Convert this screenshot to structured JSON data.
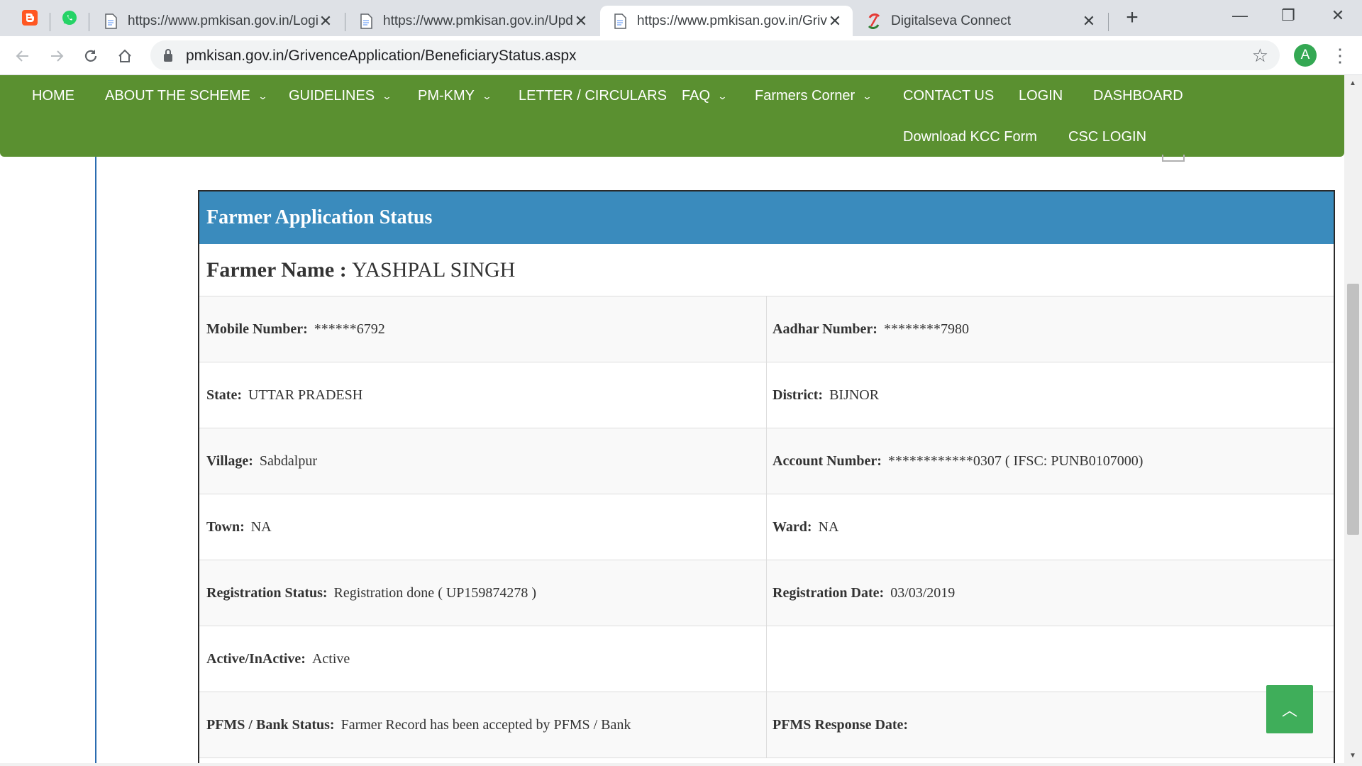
{
  "browser": {
    "pinned_tabs": [
      {
        "icon": "blogger-icon",
        "color": "#ff5722"
      },
      {
        "icon": "whatsapp-icon",
        "color": "#25d366"
      }
    ],
    "tabs": [
      {
        "title": "https://www.pmkisan.gov.in/Logi",
        "active": false
      },
      {
        "title": "https://www.pmkisan.gov.in/Upd",
        "active": false
      },
      {
        "title": "https://www.pmkisan.gov.in/Griv",
        "active": true
      },
      {
        "title": "Digitalseva Connect",
        "active": false
      }
    ],
    "close_glyph": "✕",
    "new_tab_glyph": "+",
    "window_controls": {
      "minimize": "—",
      "restore": "❐",
      "close": "✕"
    },
    "url_domain": "pmkisan.gov.in",
    "url_path": "/GrivenceApplication/BeneficiaryStatus.aspx",
    "profile_initial": "A"
  },
  "site_nav": {
    "items": [
      {
        "label": "HOME",
        "dropdown": false
      },
      {
        "label": "ABOUT THE SCHEME",
        "dropdown": true
      },
      {
        "label": "GUIDELINES",
        "dropdown": true
      },
      {
        "label": "PM-KMY",
        "dropdown": true
      },
      {
        "label": "LETTER / CIRCULARS",
        "dropdown": false
      },
      {
        "label": "FAQ",
        "dropdown": true
      },
      {
        "label": "Farmers Corner",
        "dropdown": true
      },
      {
        "label": "CONTACT US",
        "dropdown": false
      },
      {
        "label": "LOGIN",
        "dropdown": false
      },
      {
        "label": "DASHBOARD",
        "dropdown": false
      },
      {
        "label": "Download KCC Form",
        "dropdown": false
      },
      {
        "label": "CSC LOGIN",
        "dropdown": false
      }
    ],
    "chevron": "⌄",
    "background": "#5a9030"
  },
  "status_card": {
    "title": "Farmer Application Status",
    "header_color": "#3a8bbd",
    "farmer_name_label": "Farmer Name :",
    "farmer_name": "YASHPAL SINGH",
    "rows": [
      {
        "left_label": "Mobile Number:",
        "left_value": "******6792",
        "right_label": "Aadhar Number:",
        "right_value": "********7980"
      },
      {
        "left_label": "State:",
        "left_value": "UTTAR PRADESH",
        "right_label": "District:",
        "right_value": "BIJNOR"
      },
      {
        "left_label": "Village:",
        "left_value": "Sabdalpur",
        "right_label": "Account Number:",
        "right_value": "************0307 ( IFSC: PUNB0107000)"
      },
      {
        "left_label": "Town:",
        "left_value": "NA",
        "right_label": "Ward:",
        "right_value": "NA"
      },
      {
        "left_label": "Registration Status:",
        "left_value": "Registration done ( UP159874278 )",
        "right_label": "Registration Date:",
        "right_value": "03/03/2019"
      },
      {
        "left_label": "Active/InActive:",
        "left_value": "Active",
        "right_label": "",
        "right_value": ""
      },
      {
        "left_label": "PFMS / Bank Status:",
        "left_value": "Farmer Record has been accepted by PFMS / Bank",
        "right_label": "PFMS Response Date:",
        "right_value": ""
      }
    ]
  },
  "back_to_top_glyph": "︿",
  "back_to_top_color": "#3fae5a"
}
